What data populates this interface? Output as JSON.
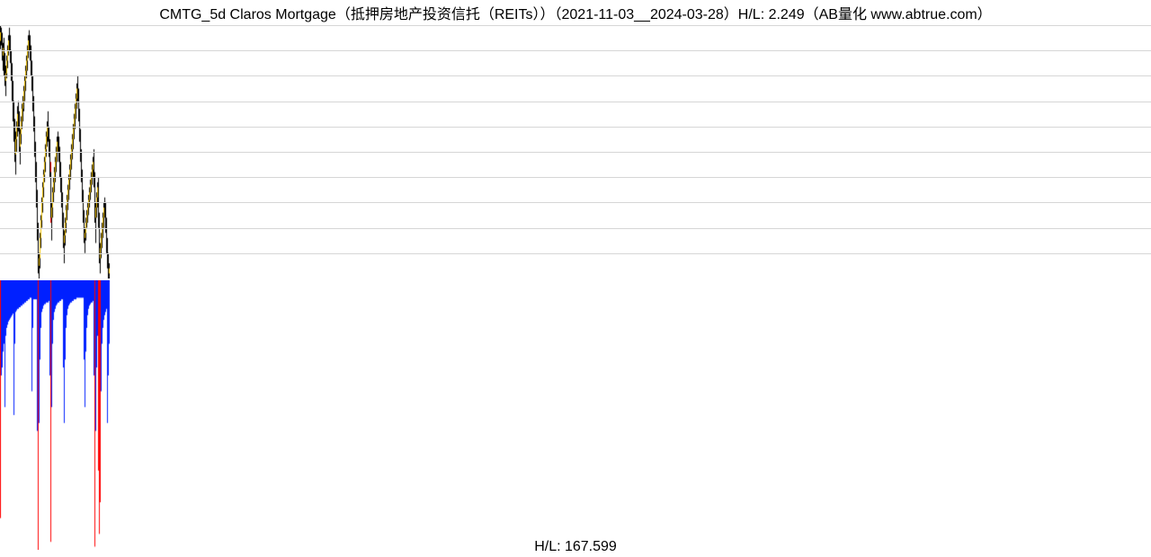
{
  "title_full": "CMTG_5d Claros Mortgage（抵押房地产投资信托（REITs））（2021-11-03__2024-03-28）H/L: 2.249（AB量化  www.abtrue.com）",
  "footer_label": "H/L: 167.599",
  "colors": {
    "grid": "#d6d6d6",
    "up_fill": "#f7c600",
    "down_fill": "#000000",
    "wick": "#000000",
    "major_down_wick": "#ff0000",
    "vol_bar": "#0020ff",
    "vol_major": "#ff0000"
  },
  "chart_data": {
    "type": "bar",
    "title": "CMTG_5d Claros Mortgage（抵押房地产投资信托（REITs））（2021-11-03__2024-03-28）H/L: 2.249（AB量化  www.abtrue.com）",
    "subtitle": "H/L: 167.599",
    "xlabel": "",
    "ylabel": "",
    "ylim_price": [
      8.0,
      18.0
    ],
    "ylim_volume": [
      0,
      170
    ],
    "gridline_levels": [
      18.0,
      17.0,
      16.0,
      15.0,
      14.0,
      13.0,
      12.0,
      11.0,
      10.0,
      9.0
    ],
    "date_range": [
      "2021-11-03",
      "2024-03-28"
    ],
    "hl_ratio_price": 2.249,
    "hl_ratio_volume": 167.599,
    "bars_total": 1280,
    "bars_with_data": 122,
    "series": [
      {
        "name": "OHLC",
        "kind": "candlestick",
        "columns": [
          "open",
          "high",
          "low",
          "close"
        ],
        "values": [
          [
            17.38,
            18.0,
            17.05,
            17.72
          ],
          [
            17.72,
            17.9,
            17.2,
            17.35
          ],
          [
            17.35,
            17.7,
            16.6,
            16.8
          ],
          [
            16.8,
            17.3,
            16.2,
            17.1
          ],
          [
            17.1,
            17.5,
            16.0,
            16.3
          ],
          [
            16.3,
            16.9,
            15.6,
            15.8
          ],
          [
            15.8,
            16.4,
            15.2,
            16.1
          ],
          [
            16.1,
            16.8,
            15.9,
            16.6
          ],
          [
            16.6,
            17.2,
            16.3,
            17.0
          ],
          [
            17.0,
            17.6,
            16.8,
            17.4
          ],
          [
            17.4,
            17.9,
            17.0,
            17.2
          ],
          [
            17.2,
            17.6,
            16.5,
            16.7
          ],
          [
            16.7,
            17.0,
            15.8,
            16.0
          ],
          [
            16.0,
            16.5,
            15.0,
            15.2
          ],
          [
            15.2,
            15.8,
            14.2,
            14.5
          ],
          [
            14.5,
            15.0,
            13.4,
            13.6
          ],
          [
            13.6,
            14.3,
            12.6,
            12.9
          ],
          [
            12.9,
            13.8,
            12.1,
            13.5
          ],
          [
            13.5,
            14.2,
            13.0,
            14.0
          ],
          [
            14.0,
            14.8,
            13.6,
            14.5
          ],
          [
            14.5,
            15.0,
            13.8,
            14.0
          ],
          [
            14.0,
            14.6,
            13.0,
            13.2
          ],
          [
            13.2,
            13.9,
            12.5,
            13.7
          ],
          [
            13.7,
            14.4,
            13.3,
            14.2
          ],
          [
            14.2,
            14.9,
            13.9,
            14.7
          ],
          [
            14.7,
            15.2,
            14.2,
            15.0
          ],
          [
            15.0,
            15.6,
            14.6,
            15.4
          ],
          [
            15.4,
            16.0,
            15.0,
            15.8
          ],
          [
            15.8,
            16.4,
            15.4,
            16.2
          ],
          [
            16.2,
            16.8,
            15.9,
            16.6
          ],
          [
            16.6,
            17.2,
            16.2,
            17.0
          ],
          [
            17.0,
            17.6,
            16.7,
            17.4
          ],
          [
            17.4,
            17.8,
            17.0,
            17.2
          ],
          [
            17.2,
            17.6,
            16.6,
            16.8
          ],
          [
            16.8,
            17.2,
            16.0,
            16.2
          ],
          [
            16.2,
            16.6,
            15.4,
            15.6
          ],
          [
            15.6,
            16.0,
            14.6,
            14.8
          ],
          [
            14.8,
            15.2,
            13.8,
            14.0
          ],
          [
            14.0,
            14.4,
            12.8,
            13.0
          ],
          [
            13.0,
            13.4,
            11.8,
            12.0
          ],
          [
            12.0,
            12.6,
            10.8,
            11.0
          ],
          [
            11.0,
            11.5,
            9.5,
            9.8
          ],
          [
            9.8,
            10.2,
            8.2,
            8.5
          ],
          [
            8.5,
            9.0,
            8.0,
            8.8
          ],
          [
            8.8,
            9.8,
            8.4,
            9.6
          ],
          [
            9.6,
            10.5,
            9.2,
            10.3
          ],
          [
            10.3,
            11.2,
            10.0,
            11.0
          ],
          [
            11.0,
            11.8,
            10.6,
            11.6
          ],
          [
            11.6,
            12.3,
            11.2,
            12.1
          ],
          [
            12.1,
            12.8,
            11.8,
            12.6
          ],
          [
            12.6,
            13.3,
            12.2,
            13.1
          ],
          [
            13.1,
            13.8,
            12.8,
            13.6
          ],
          [
            13.6,
            14.2,
            13.2,
            14.0
          ],
          [
            14.0,
            14.6,
            13.4,
            13.6
          ],
          [
            13.6,
            14.0,
            12.8,
            13.0
          ],
          [
            13.0,
            13.5,
            12.0,
            12.2
          ],
          [
            12.2,
            12.6,
            10.2,
            10.4
          ],
          [
            10.4,
            11.0,
            9.5,
            10.8
          ],
          [
            10.8,
            11.6,
            10.4,
            11.4
          ],
          [
            11.4,
            12.0,
            11.0,
            11.8
          ],
          [
            11.8,
            12.4,
            11.4,
            12.2
          ],
          [
            12.2,
            12.8,
            11.8,
            12.6
          ],
          [
            12.6,
            13.2,
            12.2,
            13.0
          ],
          [
            13.0,
            13.6,
            12.6,
            13.4
          ],
          [
            13.4,
            13.8,
            13.0,
            13.2
          ],
          [
            13.2,
            13.6,
            12.6,
            12.8
          ],
          [
            12.8,
            13.2,
            12.0,
            12.2
          ],
          [
            12.2,
            12.6,
            11.4,
            11.6
          ],
          [
            11.6,
            12.0,
            10.8,
            11.0
          ],
          [
            11.0,
            11.4,
            10.0,
            10.2
          ],
          [
            10.2,
            10.6,
            9.2,
            9.4
          ],
          [
            9.4,
            9.9,
            8.6,
            9.7
          ],
          [
            9.7,
            10.4,
            9.3,
            10.2
          ],
          [
            10.2,
            10.9,
            9.8,
            10.7
          ],
          [
            10.7,
            11.3,
            10.3,
            11.1
          ],
          [
            11.1,
            11.7,
            10.7,
            11.5
          ],
          [
            11.5,
            12.1,
            11.1,
            11.9
          ],
          [
            11.9,
            12.5,
            11.5,
            12.3
          ],
          [
            12.3,
            12.9,
            11.9,
            12.7
          ],
          [
            12.7,
            13.3,
            12.3,
            13.1
          ],
          [
            13.1,
            13.7,
            12.7,
            13.5
          ],
          [
            13.5,
            14.1,
            13.1,
            13.9
          ],
          [
            13.9,
            14.5,
            13.5,
            14.3
          ],
          [
            14.3,
            14.9,
            13.9,
            14.7
          ],
          [
            14.7,
            15.3,
            14.3,
            15.1
          ],
          [
            15.1,
            15.7,
            14.7,
            15.5
          ],
          [
            15.5,
            16.0,
            15.0,
            15.2
          ],
          [
            15.2,
            15.5,
            14.2,
            14.4
          ],
          [
            14.4,
            14.7,
            13.4,
            13.6
          ],
          [
            13.6,
            13.9,
            12.6,
            12.8
          ],
          [
            12.8,
            13.1,
            11.8,
            12.0
          ],
          [
            12.0,
            12.3,
            11.0,
            11.2
          ],
          [
            11.2,
            11.5,
            10.2,
            10.4
          ],
          [
            10.4,
            10.7,
            9.4,
            9.6
          ],
          [
            9.6,
            10.0,
            9.0,
            9.8
          ],
          [
            9.8,
            10.4,
            9.5,
            10.2
          ],
          [
            10.2,
            10.7,
            10.0,
            10.5
          ],
          [
            10.5,
            11.0,
            10.2,
            10.8
          ],
          [
            10.8,
            11.3,
            10.5,
            11.1
          ],
          [
            11.1,
            11.6,
            10.8,
            11.4
          ],
          [
            11.4,
            11.9,
            11.1,
            11.7
          ],
          [
            11.7,
            12.2,
            11.4,
            12.0
          ],
          [
            12.0,
            12.5,
            11.7,
            12.3
          ],
          [
            12.3,
            12.8,
            12.0,
            12.6
          ],
          [
            12.6,
            13.1,
            11.6,
            11.8
          ],
          [
            11.8,
            12.2,
            10.2,
            10.4
          ],
          [
            10.4,
            11.0,
            9.4,
            10.8
          ],
          [
            10.8,
            11.4,
            10.4,
            11.2
          ],
          [
            11.2,
            11.8,
            10.8,
            11.6
          ],
          [
            11.6,
            12.0,
            10.0,
            10.2
          ],
          [
            10.2,
            10.6,
            8.6,
            8.8
          ],
          [
            8.8,
            9.4,
            8.2,
            9.2
          ],
          [
            9.2,
            9.8,
            8.8,
            9.6
          ],
          [
            9.6,
            10.2,
            9.2,
            10.0
          ],
          [
            10.0,
            10.6,
            9.6,
            10.4
          ],
          [
            10.4,
            11.0,
            10.0,
            10.8
          ],
          [
            10.8,
            11.2,
            10.4,
            10.6
          ],
          [
            10.6,
            11.0,
            9.8,
            10.0
          ],
          [
            10.0,
            10.4,
            9.0,
            9.2
          ],
          [
            9.2,
            9.6,
            8.4,
            8.6
          ],
          [
            8.6,
            9.0,
            8.0,
            8.2
          ],
          [
            8.2,
            8.6,
            8.0,
            8.4
          ]
        ]
      },
      {
        "name": "Volume",
        "kind": "volume",
        "values": [
          150,
          60,
          55,
          45,
          40,
          80,
          35,
          30,
          28,
          26,
          25,
          24,
          23,
          22,
          21,
          85,
          40,
          20,
          19,
          18,
          18,
          17,
          17,
          16,
          16,
          15,
          15,
          14,
          14,
          13,
          13,
          12,
          12,
          11,
          11,
          70,
          30,
          12,
          12,
          12,
          12,
          95,
          170,
          90,
          50,
          30,
          20,
          18,
          16,
          15,
          15,
          14,
          14,
          14,
          13,
          60,
          165,
          80,
          40,
          25,
          20,
          18,
          16,
          15,
          14,
          14,
          13,
          13,
          12,
          12,
          55,
          90,
          50,
          30,
          22,
          18,
          16,
          15,
          14,
          14,
          13,
          13,
          12,
          12,
          12,
          11,
          11,
          11,
          11,
          11,
          11,
          11,
          11,
          50,
          80,
          45,
          30,
          22,
          18,
          16,
          15,
          14,
          14,
          13,
          60,
          168,
          95,
          55,
          35,
          120,
          160,
          140,
          70,
          40,
          30,
          25,
          22,
          20,
          18,
          90,
          60,
          40
        ]
      }
    ]
  }
}
